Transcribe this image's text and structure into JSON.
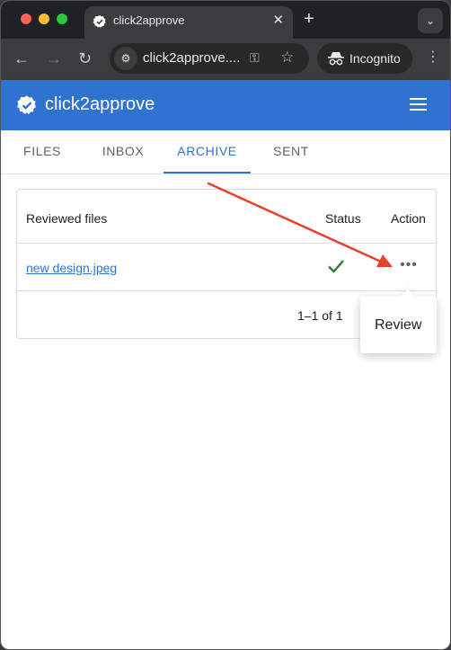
{
  "browser": {
    "tab_title": "click2approve",
    "tab_close": "✕",
    "new_tab": "+",
    "tab_menu": "⌄",
    "url": "click2approve....",
    "incognito_label": "Incognito"
  },
  "app": {
    "title": "click2approve",
    "tabs": [
      {
        "label": "FILES"
      },
      {
        "label": "INBOX"
      },
      {
        "label": "ARCHIVE"
      },
      {
        "label": "SENT"
      }
    ],
    "active_tab": "ARCHIVE"
  },
  "table": {
    "headers": {
      "name": "Reviewed files",
      "status": "Status",
      "action": "Action"
    },
    "rows": [
      {
        "file": "new design.jpeg",
        "status": "approved"
      }
    ],
    "pagination": "1–1 of 1"
  },
  "popover": {
    "item": "Review"
  },
  "colors": {
    "primary": "#2f72d0",
    "approved": "#2e7d32",
    "annotation_arrow": "#e8412b"
  }
}
